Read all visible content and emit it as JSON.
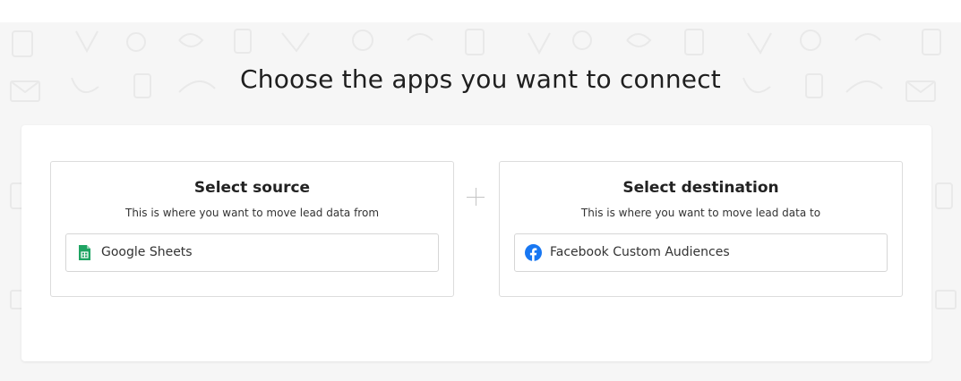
{
  "heading": "Choose the apps you want to connect",
  "source": {
    "title": "Select source",
    "subtitle": "This is where you want to move lead data from",
    "selected_app": "Google Sheets",
    "icon": "google-sheets-icon"
  },
  "destination": {
    "title": "Select destination",
    "subtitle": "This is where you want to move lead data to",
    "selected_app": "Facebook Custom Audiences",
    "icon": "facebook-icon"
  },
  "colors": {
    "sheets_green": "#1fa463",
    "facebook_blue": "#1877f2",
    "background": "#f6f6f6"
  }
}
